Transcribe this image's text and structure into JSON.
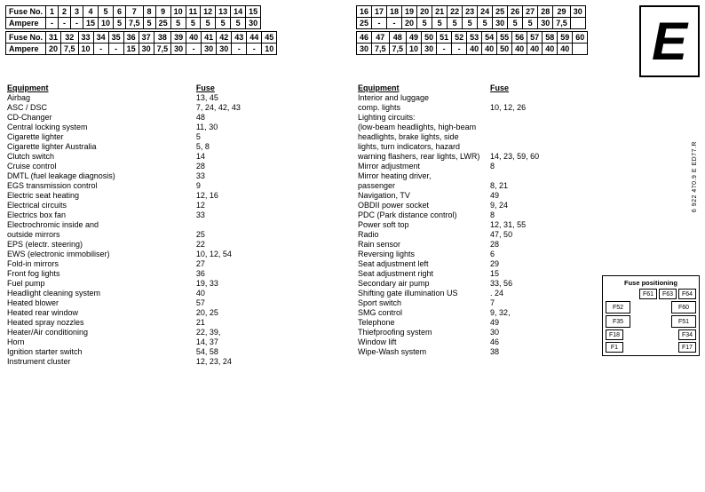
{
  "leftTable1": {
    "headers": [
      "Fuse No.",
      "1",
      "2",
      "3",
      "4",
      "5",
      "6",
      "7",
      "8",
      "9",
      "10",
      "11",
      "12",
      "13",
      "14",
      "15"
    ],
    "row1Label": "Ampere",
    "row1": [
      "-",
      "-",
      "-",
      "15",
      "10",
      "5",
      "7,5",
      "5",
      "25",
      "5",
      "5",
      "5",
      "5",
      "5",
      "30"
    ],
    "row2Headers": [
      "Fuse No.",
      "31",
      "32",
      "33",
      "34",
      "35",
      "36",
      "37",
      "38",
      "39",
      "40",
      "41",
      "42",
      "43",
      "44",
      "45"
    ],
    "row2Label": "Ampere",
    "row2": [
      "20",
      "7,5",
      "10",
      "-",
      "-",
      "15",
      "30",
      "7,5",
      "30",
      "-",
      "30",
      "30",
      "-",
      "-",
      "10"
    ]
  },
  "rightTable1": {
    "headers": [
      "16",
      "17",
      "18",
      "19",
      "20",
      "21",
      "22",
      "23",
      "24",
      "25",
      "26",
      "27",
      "28",
      "29",
      "30"
    ],
    "row1": [
      "25",
      "-",
      "-",
      "20",
      "5",
      "5",
      "5",
      "5",
      "5",
      "30",
      "5",
      "5",
      "30",
      "7,5"
    ],
    "headers2": [
      "46",
      "47",
      "48",
      "49",
      "50",
      "51",
      "52",
      "53",
      "54",
      "55",
      "56",
      "57",
      "58",
      "59",
      "60"
    ],
    "row2": [
      "30",
      "7,5",
      "7,5",
      "10",
      "30",
      "-",
      "-",
      "40",
      "40",
      "50",
      "40",
      "40",
      "40",
      "40"
    ]
  },
  "bigE": "E",
  "leftEquipment": {
    "title": "Equipment",
    "fuseTitle": "Fuse",
    "items": [
      {
        "name": "Airbag",
        "fuse": "13, 45"
      },
      {
        "name": "ASC / DSC",
        "fuse": "7, 24, 42, 43"
      },
      {
        "name": "CD-Changer",
        "fuse": "48"
      },
      {
        "name": "Central locking system",
        "fuse": "11, 30"
      },
      {
        "name": "Cigarette lighter",
        "fuse": "5"
      },
      {
        "name": "Cigarette lighter Australia",
        "fuse": "5, 8"
      },
      {
        "name": "Clutch switch",
        "fuse": "14"
      },
      {
        "name": "Cruise control",
        "fuse": "28"
      },
      {
        "name": "DMTL (fuel leakage diagnosis)",
        "fuse": "33"
      },
      {
        "name": "EGS transmission control",
        "fuse": "9"
      },
      {
        "name": "Electric seat heating",
        "fuse": "12, 16"
      },
      {
        "name": "Electrical circuits",
        "fuse": "12"
      },
      {
        "name": "Electrics box fan",
        "fuse": "33"
      },
      {
        "name": "Electrochromic inside and",
        "fuse": ""
      },
      {
        "name": "outside mirrors",
        "fuse": "25"
      },
      {
        "name": "EPS (electr. steering)",
        "fuse": "22"
      },
      {
        "name": "EWS (electronic immobiliser)",
        "fuse": "10, 12, 54"
      },
      {
        "name": "Fold-in mirrors",
        "fuse": "27"
      },
      {
        "name": "Front fog lights",
        "fuse": "36"
      },
      {
        "name": "Fuel pump",
        "fuse": "19, 33"
      },
      {
        "name": "Headlight cleaning system",
        "fuse": "40"
      },
      {
        "name": "Heated blower",
        "fuse": "57"
      },
      {
        "name": "Heated rear window",
        "fuse": "20, 25"
      },
      {
        "name": "Heated spray nozzles",
        "fuse": "21"
      },
      {
        "name": "Heater/Air conditioning",
        "fuse": "22, 39,"
      },
      {
        "name": "Horn",
        "fuse": "14, 37"
      },
      {
        "name": "Ignition starter switch",
        "fuse": "54, 58"
      },
      {
        "name": "Instrument cluster",
        "fuse": "12, 23, 24"
      }
    ]
  },
  "rightEquipment": {
    "title": "Equipment",
    "fuseTitle": "Fuse",
    "items": [
      {
        "name": "Interior and luggage",
        "fuse": ""
      },
      {
        "name": "comp. lights",
        "fuse": "10, 12, 26"
      },
      {
        "name": "Lighting circuits:",
        "fuse": ""
      },
      {
        "name": "(low-beam headlights, high-beam",
        "fuse": ""
      },
      {
        "name": "headlights, brake lights, side",
        "fuse": ""
      },
      {
        "name": "lights, turn indicators, hazard",
        "fuse": ""
      },
      {
        "name": "warning flashers, rear lights, LWR)",
        "fuse": "14, 23, 59, 60"
      },
      {
        "name": "Mirror adjustment",
        "fuse": "8"
      },
      {
        "name": "Mirror heating driver,",
        "fuse": ""
      },
      {
        "name": "passenger",
        "fuse": "8, 21"
      },
      {
        "name": "Navigation, TV",
        "fuse": "49"
      },
      {
        "name": "OBDII power socket",
        "fuse": "9, 24"
      },
      {
        "name": "PDC (Park distance control)",
        "fuse": "8"
      },
      {
        "name": "Power soft top",
        "fuse": "12, 31, 55"
      },
      {
        "name": "Radio",
        "fuse": "47, 50"
      },
      {
        "name": "Rain sensor",
        "fuse": "28"
      },
      {
        "name": "Reversing lights",
        "fuse": "6"
      },
      {
        "name": "Seat adjustment left",
        "fuse": "29"
      },
      {
        "name": "Seat adjustment right",
        "fuse": "15"
      },
      {
        "name": "Secondary air pump",
        "fuse": "33, 56"
      },
      {
        "name": "Shifting gate illumination US",
        "fuse": ". 24"
      },
      {
        "name": "Sport switch",
        "fuse": "7"
      },
      {
        "name": "SMG control",
        "fuse": "9, 32,"
      },
      {
        "name": "Telephone",
        "fuse": "49"
      },
      {
        "name": "Thiefproofing system",
        "fuse": "30"
      },
      {
        "name": "Window lift",
        "fuse": "46"
      },
      {
        "name": "Wipe-Wash system",
        "fuse": "38"
      }
    ]
  },
  "partNumber": "6 922 470.9 E ED77.R",
  "fusePositioning": {
    "title": "Fuse positioning",
    "topRow": [
      "F61",
      "F63",
      "F64"
    ],
    "row2": [
      {
        "label": "F52",
        "wide": true
      },
      {
        "label": "F60",
        "wide": true
      }
    ],
    "row3": [
      {
        "label": "F35",
        "wide": true
      },
      {
        "label": "F51",
        "wide": true
      }
    ],
    "row4": [
      {
        "label": "F18"
      },
      {
        "label": "F34"
      }
    ],
    "row5": [
      {
        "label": "F1"
      },
      {
        "label": "F17"
      }
    ]
  }
}
